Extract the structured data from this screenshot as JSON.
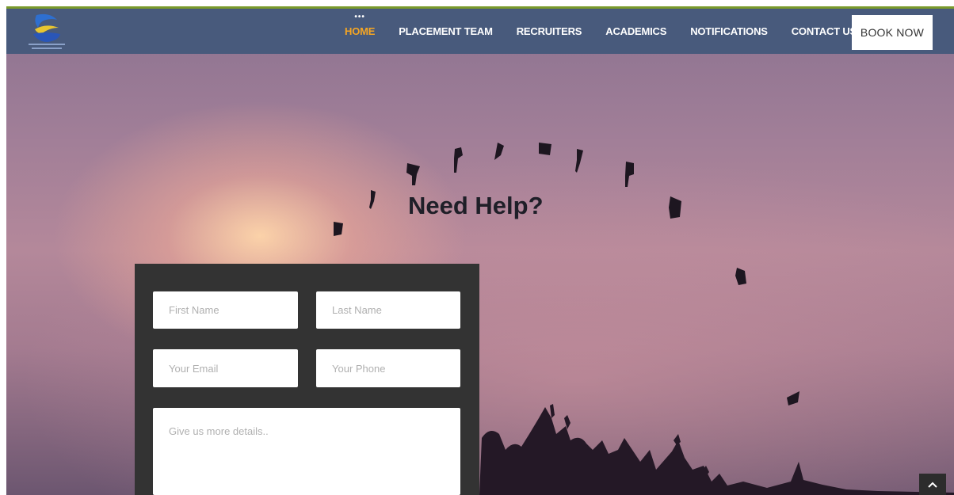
{
  "nav": {
    "items": [
      {
        "label": "HOME",
        "active": true
      },
      {
        "label": "PLACEMENT TEAM",
        "active": false
      },
      {
        "label": "RECRUITERS",
        "active": false
      },
      {
        "label": "ACADEMICS",
        "active": false
      },
      {
        "label": "NOTIFICATIONS",
        "active": false
      },
      {
        "label": "CONTACT US",
        "active": false
      }
    ],
    "active_marker": "•••",
    "book_now": "BOOK NOW"
  },
  "hero": {
    "heading": "Need Help?"
  },
  "form": {
    "first_name_placeholder": "First Name",
    "last_name_placeholder": "Last Name",
    "email_placeholder": "Your Email",
    "phone_placeholder": "Your Phone",
    "details_placeholder": "Give us more details.."
  },
  "icons": {
    "logo": "university-logo",
    "scroll_top": "chevron-up-icon"
  },
  "colors": {
    "navbar": "#485a7c",
    "active_nav": "#f6a623",
    "form_panel": "#333333",
    "accent_line": "#7a9a2c"
  }
}
